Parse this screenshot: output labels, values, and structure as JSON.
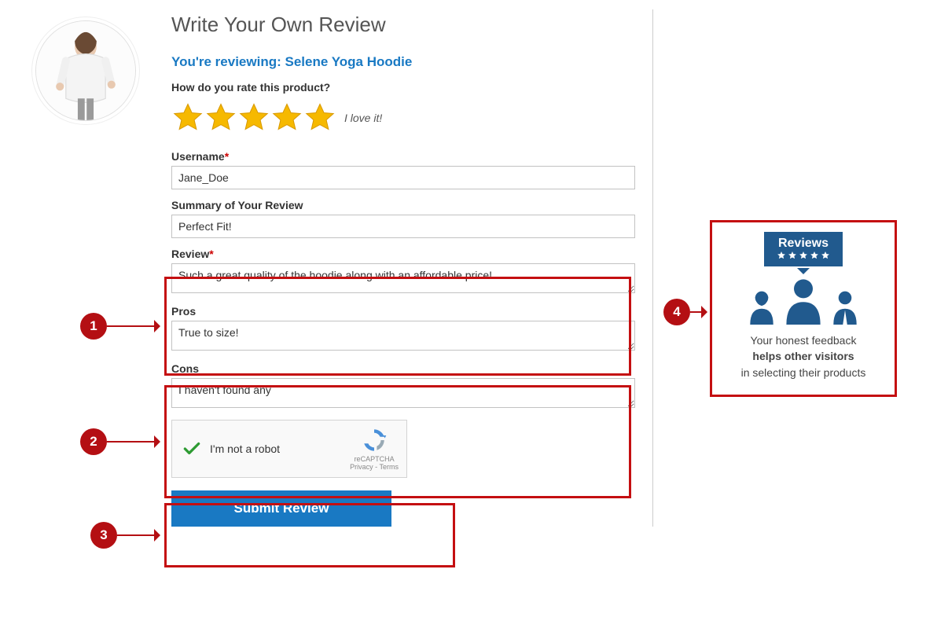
{
  "title": "Write Your Own Review",
  "reviewing_prefix": "You're reviewing: ",
  "product_name": "Selene Yoga Hoodie",
  "rate_question": "How do you rate this product?",
  "rating_label": "I love it!",
  "rating_value": 5,
  "fields": {
    "username": {
      "label": "Username",
      "required": true,
      "value": "Jane_Doe"
    },
    "summary": {
      "label": "Summary of Your Review",
      "required": false,
      "value": "Perfect Fit!"
    },
    "review": {
      "label": "Review",
      "required": true,
      "value": "Such a great quality of the hoodie along with an affordable price!"
    },
    "pros": {
      "label": "Pros",
      "required": false,
      "value": "True to size!"
    },
    "cons": {
      "label": "Cons",
      "required": false,
      "value": "I haven't found any"
    }
  },
  "captcha": {
    "label": "I'm not a robot",
    "brand": "reCAPTCHA",
    "privacy": "Privacy",
    "terms": "Terms",
    "checked": true
  },
  "submit_label": "Submit Review",
  "promo": {
    "bubble_title": "Reviews",
    "line1": "Your honest feedback",
    "line2_bold": "helps other visitors",
    "line3": "in selecting their products"
  },
  "callouts": [
    "1",
    "2",
    "3",
    "4"
  ]
}
